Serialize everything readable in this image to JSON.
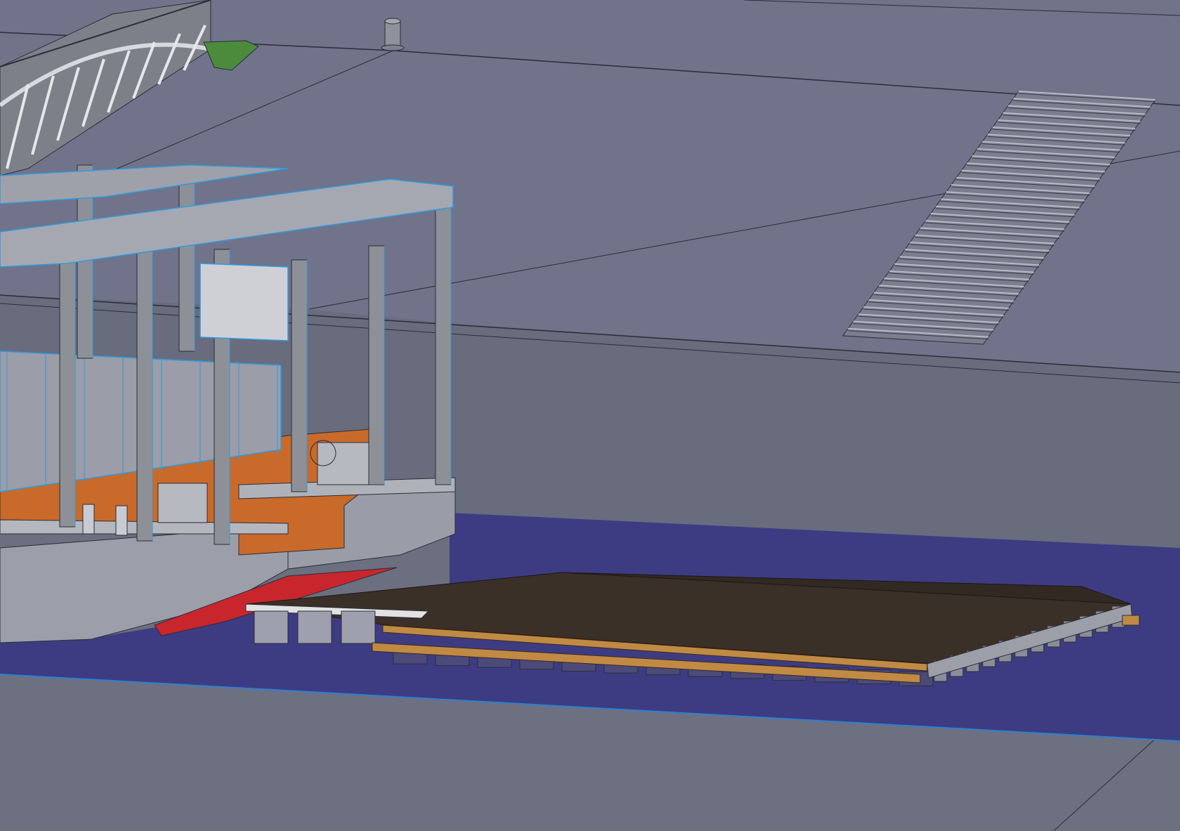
{
  "scene": {
    "palette": {
      "quay": "#6d7182",
      "quay_upper": "#70738a",
      "quay_face": "#666a7a",
      "water": "#3d3c82",
      "water_edge": "#2f7fd0",
      "edge_line": "#2b2d38",
      "hull": "#9a9ca7",
      "hull_dark": "#7c7e8a",
      "frame": "#8e9098",
      "frame_edge": "#2e9be0",
      "orange": "#c96a2a",
      "red": "#c8262c",
      "deck_dark": "#3b3028",
      "timber": "#c08a45",
      "float_block": "#4b4a7a",
      "bridge": "#a9abb3",
      "grass": "#4b8b3b"
    },
    "objects": [
      {
        "name": "quay-surface"
      },
      {
        "name": "quay-wall"
      },
      {
        "name": "harbour-water"
      },
      {
        "name": "stair-ramp"
      },
      {
        "name": "bollard-post"
      },
      {
        "name": "truss-footbridge"
      },
      {
        "name": "pontoon-vessel"
      },
      {
        "name": "floating-dock"
      }
    ]
  }
}
